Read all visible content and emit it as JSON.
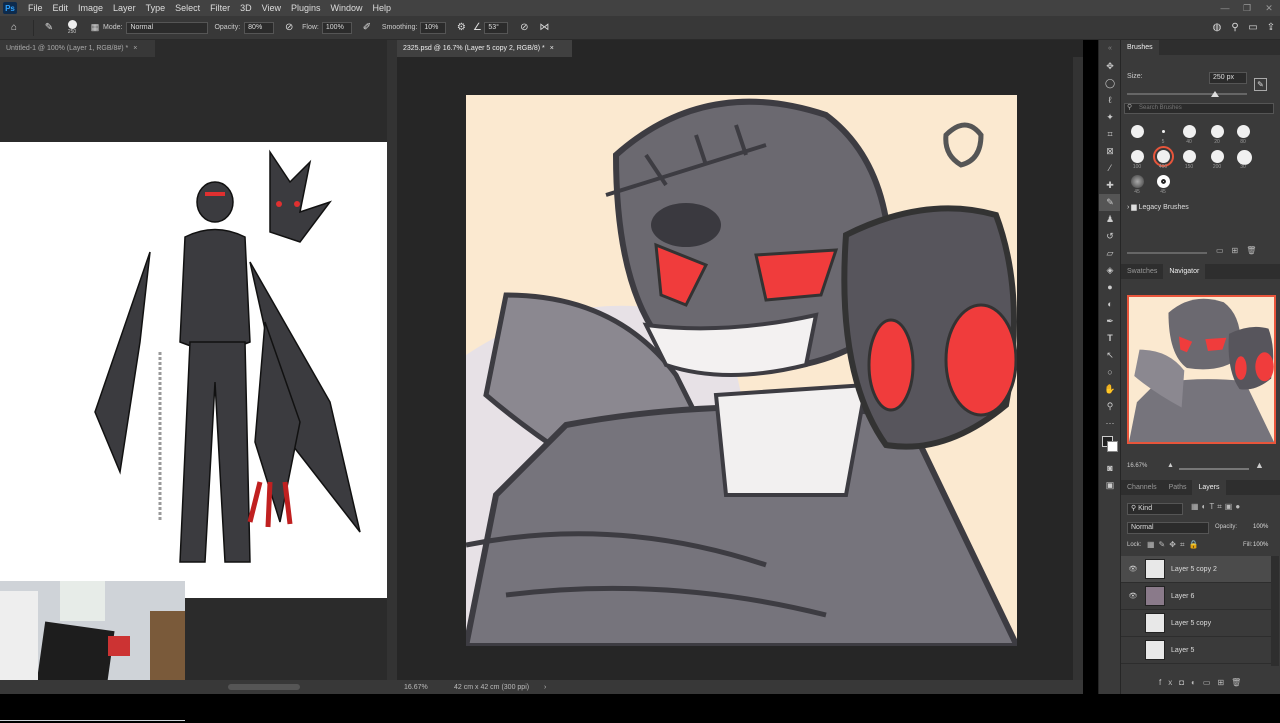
{
  "menu": [
    "File",
    "Edit",
    "Image",
    "Layer",
    "Type",
    "Select",
    "Filter",
    "3D",
    "View",
    "Plugins",
    "Window",
    "Help"
  ],
  "options": {
    "brush_size": "250",
    "mode_label": "Mode:",
    "mode_value": "Normal",
    "opacity_label": "Opacity:",
    "opacity_value": "80%",
    "flow_label": "Flow:",
    "flow_value": "100%",
    "smoothing_label": "Smoothing:",
    "smoothing_value": "10%",
    "angle_value": "53°"
  },
  "tabs": {
    "left": "Untitled-1 @ 100% (Layer 1, RGB/8#) *",
    "right": "2325.psd @ 16.7% (Layer 5 copy 2, RGB/8) *"
  },
  "status": {
    "zoom": "16.67%",
    "doc_size": "42 cm x 42 cm (300 ppi)"
  },
  "brushes_panel": {
    "title": "Brushes",
    "size_label": "Size:",
    "size_value": "250 px",
    "search_placeholder": "Search Brushes",
    "legacy": "Legacy Brushes",
    "presets": [
      {
        "label": "",
        "size": "sm"
      },
      {
        "label": "5",
        "size": "dot"
      },
      {
        "label": "40",
        "size": "md"
      },
      {
        "label": "20",
        "size": "md"
      },
      {
        "label": "80",
        "size": "md"
      },
      {
        "label": "100",
        "size": "md"
      },
      {
        "label": "400",
        "size": "md"
      },
      {
        "label": "150",
        "size": "md"
      },
      {
        "label": "200",
        "size": "md"
      },
      {
        "label": "30",
        "size": "lg"
      },
      {
        "label": "45",
        "size": "soft"
      },
      {
        "label": "45",
        "size": "ring"
      }
    ]
  },
  "navigator": {
    "tabs": [
      "Swatches",
      "Navigator"
    ],
    "zoom": "16.67%"
  },
  "layers_panel": {
    "tabs": [
      "Channels",
      "Paths",
      "Layers"
    ],
    "kind": "Kind",
    "blend": "Normal",
    "opacity_label": "Opacity:",
    "opacity_value": "100%",
    "lock_label": "Lock:",
    "fill_label": "Fill:",
    "fill_value": "100%",
    "layers": [
      {
        "name": "Layer 5 copy 2",
        "visible": true,
        "selected": true
      },
      {
        "name": "Layer 6",
        "visible": true,
        "selected": false
      },
      {
        "name": "Layer 5 copy",
        "visible": false,
        "selected": false
      },
      {
        "name": "Layer 5",
        "visible": false,
        "selected": false
      }
    ]
  },
  "colors": {
    "accent": "#e8553b",
    "eye_red": "#f03c3c",
    "canvas_bg": "#fbe9d0",
    "select_row": "#4b4b4b"
  }
}
